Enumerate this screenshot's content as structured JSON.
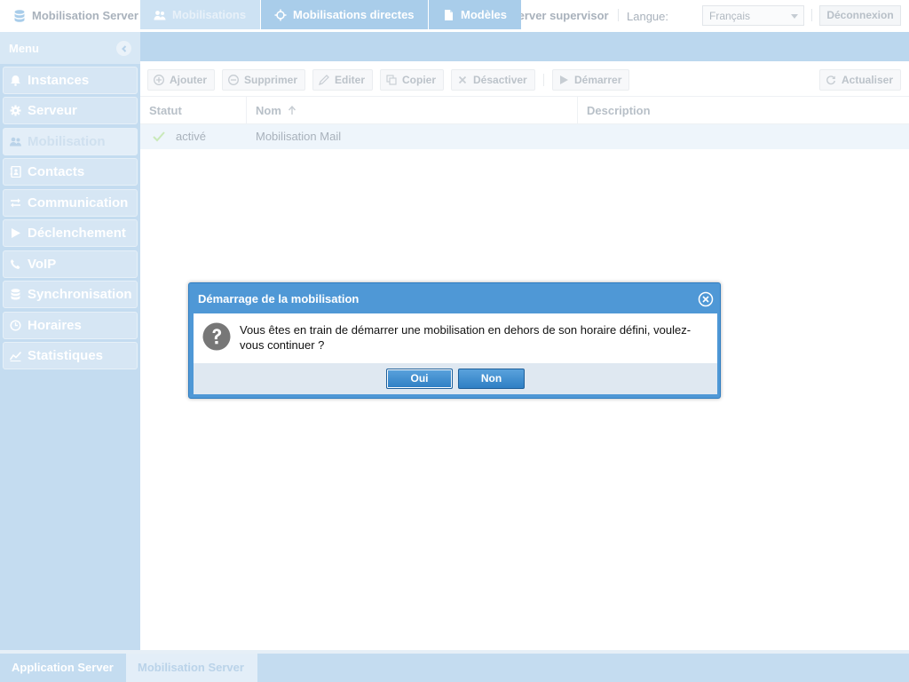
{
  "header": {
    "app_title": "Mobilisation Server",
    "user": "Server supervisor",
    "language_label": "Langue:",
    "language_value": "Français",
    "logout_label": "Déconnexion"
  },
  "sidebar": {
    "title": "Menu",
    "items": [
      {
        "label": "Instances",
        "icon": "bell-icon"
      },
      {
        "label": "Serveur",
        "icon": "gear-icon"
      },
      {
        "label": "Mobilisation",
        "icon": "users-icon"
      },
      {
        "label": "Contacts",
        "icon": "address-book-icon"
      },
      {
        "label": "Communication",
        "icon": "exchange-arrows-icon"
      },
      {
        "label": "Déclenchement",
        "icon": "play-icon"
      },
      {
        "label": "VoIP",
        "icon": "phone-icon"
      },
      {
        "label": "Synchronisation",
        "icon": "database-icon"
      },
      {
        "label": "Horaires",
        "icon": "clock-icon"
      },
      {
        "label": "Statistiques",
        "icon": "chart-icon"
      }
    ]
  },
  "tabs": [
    {
      "label": "Mobilisations",
      "icon": "users-icon"
    },
    {
      "label": "Mobilisations directes",
      "icon": "crosshair-icon"
    },
    {
      "label": "Modèles",
      "icon": "document-icon"
    }
  ],
  "toolbar": {
    "add": "Ajouter",
    "delete": "Supprimer",
    "edit": "Editer",
    "copy": "Copier",
    "deactivate": "Désactiver",
    "start": "Démarrer",
    "refresh": "Actualiser"
  },
  "grid": {
    "columns": [
      "Statut",
      "Nom",
      "Description"
    ],
    "rows": [
      {
        "status": "activé",
        "name": "Mobilisation Mail",
        "description": ""
      }
    ]
  },
  "bottom_tabs": [
    "Application Server",
    "Mobilisation Server"
  ],
  "dialog": {
    "title": "Démarrage de la mobilisation",
    "message": "Vous êtes en train de démarrer une mobilisation en dehors de son horaire défini, voulez-vous continuer ?",
    "yes": "Oui",
    "no": "Non"
  }
}
